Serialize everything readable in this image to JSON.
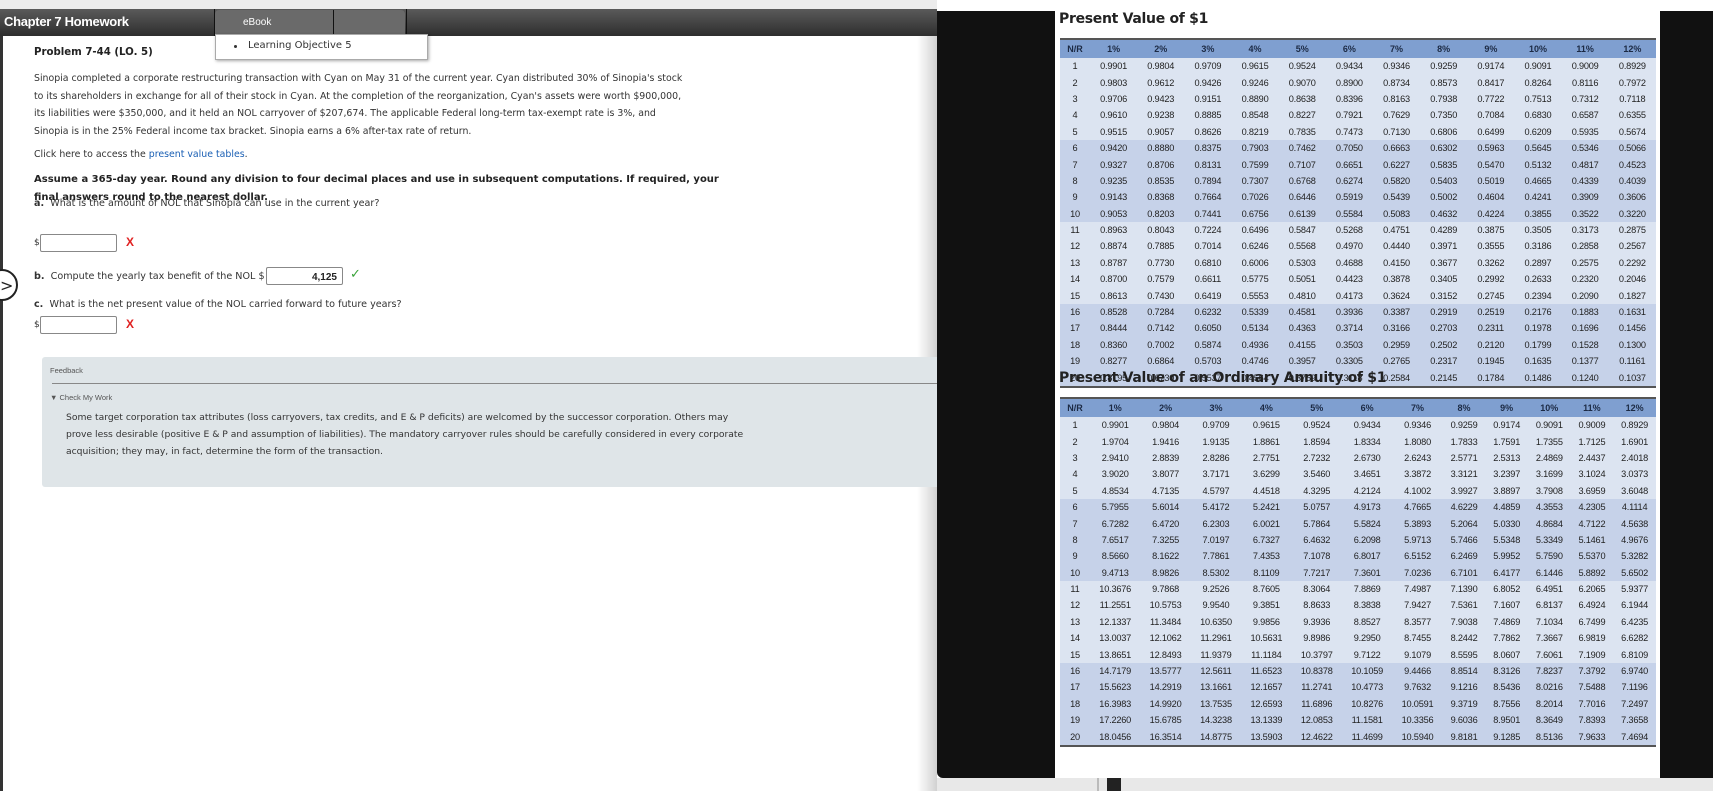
{
  "header": {
    "title": "Chapter 7 Homework",
    "tabs": [
      {
        "label": "eBook"
      },
      {
        "label": ""
      }
    ],
    "dropdown_items": [
      "Learning Objective 5"
    ]
  },
  "problem": {
    "title": "Problem 7-44 (LO. 5)",
    "intro_lines": [
      "Sinopia completed a corporate restructuring transaction with Cyan on May 31 of the current year. Cyan distributed 30% of Sinopia's stock",
      "to its shareholders in exchange for all of their stock in Cyan. At the completion of the reorganization, Cyan's assets were worth $900,000,",
      "its liabilities were $350,000, and it held an NOL carryover of $207,674. The applicable Federal long-term tax-exempt rate is 3%, and",
      "Sinopia is in the 25% Federal income tax bracket. Sinopia earns a 6% after-tax rate of return."
    ],
    "pv_link_prefix": "Click here to access the ",
    "pv_link_text": "present value tables",
    "pv_link_suffix": ".",
    "instructions_lines": [
      "Assume a 365-day year. Round any division to four decimal places and use in subsequent computations. If required, your",
      "final answers round to the nearest dollar."
    ],
    "questions": [
      {
        "letter": "a.",
        "text": "What is the amount of NOL that Sinopia can use in the current year?",
        "currency": "$",
        "value": "",
        "status": "incorrect",
        "status_glyph": "X"
      },
      {
        "letter": "b.",
        "text": "Compute the yearly tax benefit of the NOL",
        "currency": "$",
        "value": "4,125",
        "status": "correct",
        "status_glyph": "✓"
      },
      {
        "letter": "c.",
        "text": "What is the net present value of the NOL carried forward to future years?",
        "currency": "$",
        "value": "",
        "status": "incorrect",
        "status_glyph": "X"
      }
    ]
  },
  "feedback": {
    "label": "Feedback",
    "toggle": "▼ Check My Work",
    "text_lines": [
      "Some target corporation tax attributes (loss carryovers, tax credits, and E & P deficits) are welcomed by the successor corporation. Others may",
      "prove less desirable (positive E & P and assumption of liabilities). The mandatory carryover rules should be carefully considered in every corporate",
      "acquisition; they may, in fact, determine the form of the transaction."
    ]
  },
  "nav": {
    "next_glyph": ">"
  },
  "colors": {
    "header_bg": "#3a3a3a",
    "link": "#1a5fb4",
    "incorrect": "#e02020",
    "correct": "#3aa33a",
    "feedback_bg": "#dfe5e8",
    "table_header": "#7f9fd0",
    "table_band_light": "#dce4f1",
    "table_band_dark": "#c6d2e9"
  },
  "tables": [
    {
      "title": "Present Value of $1",
      "headers": [
        "N/R",
        "1%",
        "2%",
        "3%",
        "4%",
        "5%",
        "6%",
        "7%",
        "8%",
        "9%",
        "10%",
        "11%",
        "12%"
      ],
      "rows": [
        [
          "1",
          "0.9901",
          "0.9804",
          "0.9709",
          "0.9615",
          "0.9524",
          "0.9434",
          "0.9346",
          "0.9259",
          "0.9174",
          "0.9091",
          "0.9009",
          "0.8929"
        ],
        [
          "2",
          "0.9803",
          "0.9612",
          "0.9426",
          "0.9246",
          "0.9070",
          "0.8900",
          "0.8734",
          "0.8573",
          "0.8417",
          "0.8264",
          "0.8116",
          "0.7972"
        ],
        [
          "3",
          "0.9706",
          "0.9423",
          "0.9151",
          "0.8890",
          "0.8638",
          "0.8396",
          "0.8163",
          "0.7938",
          "0.7722",
          "0.7513",
          "0.7312",
          "0.7118"
        ],
        [
          "4",
          "0.9610",
          "0.9238",
          "0.8885",
          "0.8548",
          "0.8227",
          "0.7921",
          "0.7629",
          "0.7350",
          "0.7084",
          "0.6830",
          "0.6587",
          "0.6355"
        ],
        [
          "5",
          "0.9515",
          "0.9057",
          "0.8626",
          "0.8219",
          "0.7835",
          "0.7473",
          "0.7130",
          "0.6806",
          "0.6499",
          "0.6209",
          "0.5935",
          "0.5674"
        ],
        [
          "6",
          "0.9420",
          "0.8880",
          "0.8375",
          "0.7903",
          "0.7462",
          "0.7050",
          "0.6663",
          "0.6302",
          "0.5963",
          "0.5645",
          "0.5346",
          "0.5066"
        ],
        [
          "7",
          "0.9327",
          "0.8706",
          "0.8131",
          "0.7599",
          "0.7107",
          "0.6651",
          "0.6227",
          "0.5835",
          "0.5470",
          "0.5132",
          "0.4817",
          "0.4523"
        ],
        [
          "8",
          "0.9235",
          "0.8535",
          "0.7894",
          "0.7307",
          "0.6768",
          "0.6274",
          "0.5820",
          "0.5403",
          "0.5019",
          "0.4665",
          "0.4339",
          "0.4039"
        ],
        [
          "9",
          "0.9143",
          "0.8368",
          "0.7664",
          "0.7026",
          "0.6446",
          "0.5919",
          "0.5439",
          "0.5002",
          "0.4604",
          "0.4241",
          "0.3909",
          "0.3606"
        ],
        [
          "10",
          "0.9053",
          "0.8203",
          "0.7441",
          "0.6756",
          "0.6139",
          "0.5584",
          "0.5083",
          "0.4632",
          "0.4224",
          "0.3855",
          "0.3522",
          "0.3220"
        ],
        [
          "11",
          "0.8963",
          "0.8043",
          "0.7224",
          "0.6496",
          "0.5847",
          "0.5268",
          "0.4751",
          "0.4289",
          "0.3875",
          "0.3505",
          "0.3173",
          "0.2875"
        ],
        [
          "12",
          "0.8874",
          "0.7885",
          "0.7014",
          "0.6246",
          "0.5568",
          "0.4970",
          "0.4440",
          "0.3971",
          "0.3555",
          "0.3186",
          "0.2858",
          "0.2567"
        ],
        [
          "13",
          "0.8787",
          "0.7730",
          "0.6810",
          "0.6006",
          "0.5303",
          "0.4688",
          "0.4150",
          "0.3677",
          "0.3262",
          "0.2897",
          "0.2575",
          "0.2292"
        ],
        [
          "14",
          "0.8700",
          "0.7579",
          "0.6611",
          "0.5775",
          "0.5051",
          "0.4423",
          "0.3878",
          "0.3405",
          "0.2992",
          "0.2633",
          "0.2320",
          "0.2046"
        ],
        [
          "15",
          "0.8613",
          "0.7430",
          "0.6419",
          "0.5553",
          "0.4810",
          "0.4173",
          "0.3624",
          "0.3152",
          "0.2745",
          "0.2394",
          "0.2090",
          "0.1827"
        ],
        [
          "16",
          "0.8528",
          "0.7284",
          "0.6232",
          "0.5339",
          "0.4581",
          "0.3936",
          "0.3387",
          "0.2919",
          "0.2519",
          "0.2176",
          "0.1883",
          "0.1631"
        ],
        [
          "17",
          "0.8444",
          "0.7142",
          "0.6050",
          "0.5134",
          "0.4363",
          "0.3714",
          "0.3166",
          "0.2703",
          "0.2311",
          "0.1978",
          "0.1696",
          "0.1456"
        ],
        [
          "18",
          "0.8360",
          "0.7002",
          "0.5874",
          "0.4936",
          "0.4155",
          "0.3503",
          "0.2959",
          "0.2502",
          "0.2120",
          "0.1799",
          "0.1528",
          "0.1300"
        ],
        [
          "19",
          "0.8277",
          "0.6864",
          "0.5703",
          "0.4746",
          "0.3957",
          "0.3305",
          "0.2765",
          "0.2317",
          "0.1945",
          "0.1635",
          "0.1377",
          "0.1161"
        ],
        [
          "20",
          "0.8195",
          "0.6730",
          "0.5537",
          "0.4564",
          "0.3769",
          "0.3118",
          "0.2584",
          "0.2145",
          "0.1784",
          "0.1486",
          "0.1240",
          "0.1037"
        ]
      ]
    },
    {
      "title": "Present Value of an Ordinary Annuity of $1",
      "headers": [
        "N/R",
        "1%",
        "2%",
        "3%",
        "4%",
        "5%",
        "6%",
        "7%",
        "8%",
        "9%",
        "10%",
        "11%",
        "12%"
      ],
      "rows": [
        [
          "1",
          "0.9901",
          "0.9804",
          "0.9709",
          "0.9615",
          "0.9524",
          "0.9434",
          "0.9346",
          "0.9259",
          "0.9174",
          "0.9091",
          "0.9009",
          "0.8929"
        ],
        [
          "2",
          "1.9704",
          "1.9416",
          "1.9135",
          "1.8861",
          "1.8594",
          "1.8334",
          "1.8080",
          "1.7833",
          "1.7591",
          "1.7355",
          "1.7125",
          "1.6901"
        ],
        [
          "3",
          "2.9410",
          "2.8839",
          "2.8286",
          "2.7751",
          "2.7232",
          "2.6730",
          "2.6243",
          "2.5771",
          "2.5313",
          "2.4869",
          "2.4437",
          "2.4018"
        ],
        [
          "4",
          "3.9020",
          "3.8077",
          "3.7171",
          "3.6299",
          "3.5460",
          "3.4651",
          "3.3872",
          "3.3121",
          "3.2397",
          "3.1699",
          "3.1024",
          "3.0373"
        ],
        [
          "5",
          "4.8534",
          "4.7135",
          "4.5797",
          "4.4518",
          "4.3295",
          "4.2124",
          "4.1002",
          "3.9927",
          "3.8897",
          "3.7908",
          "3.6959",
          "3.6048"
        ],
        [
          "6",
          "5.7955",
          "5.6014",
          "5.4172",
          "5.2421",
          "5.0757",
          "4.9173",
          "4.7665",
          "4.6229",
          "4.4859",
          "4.3553",
          "4.2305",
          "4.1114"
        ],
        [
          "7",
          "6.7282",
          "6.4720",
          "6.2303",
          "6.0021",
          "5.7864",
          "5.5824",
          "5.3893",
          "5.2064",
          "5.0330",
          "4.8684",
          "4.7122",
          "4.5638"
        ],
        [
          "8",
          "7.6517",
          "7.3255",
          "7.0197",
          "6.7327",
          "6.4632",
          "6.2098",
          "5.9713",
          "5.7466",
          "5.5348",
          "5.3349",
          "5.1461",
          "4.9676"
        ],
        [
          "9",
          "8.5660",
          "8.1622",
          "7.7861",
          "7.4353",
          "7.1078",
          "6.8017",
          "6.5152",
          "6.2469",
          "5.9952",
          "5.7590",
          "5.5370",
          "5.3282"
        ],
        [
          "10",
          "9.4713",
          "8.9826",
          "8.5302",
          "8.1109",
          "7.7217",
          "7.3601",
          "7.0236",
          "6.7101",
          "6.4177",
          "6.1446",
          "5.8892",
          "5.6502"
        ],
        [
          "11",
          "10.3676",
          "9.7868",
          "9.2526",
          "8.7605",
          "8.3064",
          "7.8869",
          "7.4987",
          "7.1390",
          "6.8052",
          "6.4951",
          "6.2065",
          "5.9377"
        ],
        [
          "12",
          "11.2551",
          "10.5753",
          "9.9540",
          "9.3851",
          "8.8633",
          "8.3838",
          "7.9427",
          "7.5361",
          "7.1607",
          "6.8137",
          "6.4924",
          "6.1944"
        ],
        [
          "13",
          "12.1337",
          "11.3484",
          "10.6350",
          "9.9856",
          "9.3936",
          "8.8527",
          "8.3577",
          "7.9038",
          "7.4869",
          "7.1034",
          "6.7499",
          "6.4235"
        ],
        [
          "14",
          "13.0037",
          "12.1062",
          "11.2961",
          "10.5631",
          "9.8986",
          "9.2950",
          "8.7455",
          "8.2442",
          "7.7862",
          "7.3667",
          "6.9819",
          "6.6282"
        ],
        [
          "15",
          "13.8651",
          "12.8493",
          "11.9379",
          "11.1184",
          "10.3797",
          "9.7122",
          "9.1079",
          "8.5595",
          "8.0607",
          "7.6061",
          "7.1909",
          "6.8109"
        ],
        [
          "16",
          "14.7179",
          "13.5777",
          "12.5611",
          "11.6523",
          "10.8378",
          "10.1059",
          "9.4466",
          "8.8514",
          "8.3126",
          "7.8237",
          "7.3792",
          "6.9740"
        ],
        [
          "17",
          "15.5623",
          "14.2919",
          "13.1661",
          "12.1657",
          "11.2741",
          "10.4773",
          "9.7632",
          "9.1216",
          "8.5436",
          "8.0216",
          "7.5488",
          "7.1196"
        ],
        [
          "18",
          "16.3983",
          "14.9920",
          "13.7535",
          "12.6593",
          "11.6896",
          "10.8276",
          "10.0591",
          "9.3719",
          "8.7556",
          "8.2014",
          "7.7016",
          "7.2497"
        ],
        [
          "19",
          "17.2260",
          "15.6785",
          "14.3238",
          "13.1339",
          "12.0853",
          "11.1581",
          "10.3356",
          "9.6036",
          "8.9501",
          "8.3649",
          "7.8393",
          "7.3658"
        ],
        [
          "20",
          "18.0456",
          "16.3514",
          "14.8775",
          "13.5903",
          "12.4622",
          "11.4699",
          "10.5940",
          "9.8181",
          "9.1285",
          "8.5136",
          "7.9633",
          "7.4694"
        ]
      ]
    }
  ]
}
